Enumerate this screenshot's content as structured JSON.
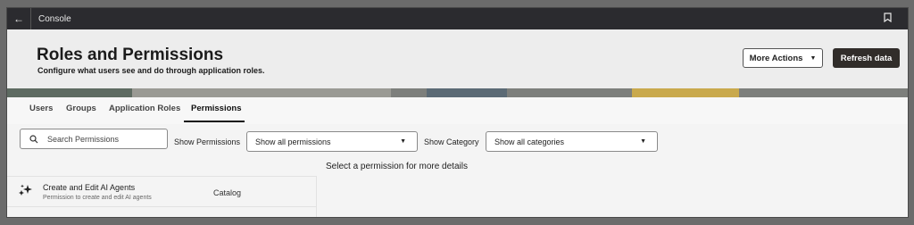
{
  "topbar": {
    "title": "Console",
    "back_icon": "back-arrow-icon",
    "bookmark_icon": "bookmark-icon"
  },
  "header": {
    "title": "Roles and Permissions",
    "subtitle": "Configure what users see and do through application roles.",
    "more_actions_label": "More Actions",
    "refresh_label": "Refresh data"
  },
  "tabs": [
    {
      "label": "Users"
    },
    {
      "label": "Groups"
    },
    {
      "label": "Application Roles"
    },
    {
      "label": "Permissions",
      "active": true
    }
  ],
  "filters": {
    "search_placeholder": "Search Permissions",
    "show_permissions_label": "Show Permissions",
    "show_permissions_value": "Show all permissions",
    "show_category_label": "Show Category",
    "show_category_value": "Show all categories"
  },
  "details_hint": "Select a permission for more details",
  "permissions": [
    {
      "name": "Create and Edit AI Agents",
      "description": "Permission to create and edit AI agents",
      "category": "Catalog",
      "icon": "ai-sparkle-icon"
    }
  ],
  "colors": {
    "primary_button": "#312d2a",
    "topbar": "#2b2b2f"
  }
}
